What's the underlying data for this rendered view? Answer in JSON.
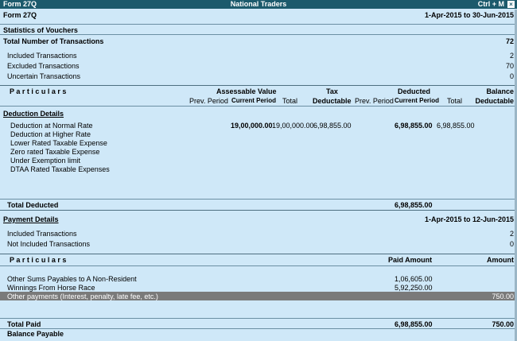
{
  "titlebar": {
    "left": "Form 27Q",
    "center": "National Traders",
    "right": "Ctrl + M",
    "close": "×"
  },
  "header": {
    "form_name": "Form 27Q",
    "period": "1-Apr-2015 to 30-Jun-2015"
  },
  "stats": {
    "title": "Statistics of Vouchers",
    "total_label": "Total Number of Transactions",
    "total_value": "72",
    "included_label": "Included Transactions",
    "included_value": "2",
    "excluded_label": "Excluded Transactions",
    "excluded_value": "70",
    "uncertain_label": "Uncertain Transactions",
    "uncertain_value": "0"
  },
  "columns": {
    "particulars": "P a r t i c u l a r s",
    "assessable": "Assessable Value",
    "tax": "Tax",
    "deducted": "Deducted",
    "balance": "Balance",
    "prev_period": "Prev. Period",
    "current_period": "Current Period",
    "total": "Total",
    "deductable": "Deductable"
  },
  "deduction": {
    "title": "Deduction Details",
    "rows": [
      {
        "label": "Deduction at Normal Rate",
        "av_current": "19,00,000.00",
        "av_total": "19,00,000.00",
        "tax": "6,98,855.00",
        "ded_current": "6,98,855.00",
        "ded_total": "6,98,855.00"
      },
      {
        "label": "Deduction at Higher Rate"
      },
      {
        "label": "Lower Rated Taxable Expense"
      },
      {
        "label": "Zero rated Taxable Expense"
      },
      {
        "label": "Under Exemption limit"
      },
      {
        "label": "DTAA Rated Taxable Expenses"
      }
    ],
    "total_label": "Total Deducted",
    "total_value": "6,98,855.00"
  },
  "payment": {
    "title": "Payment Details",
    "period": "1-Apr-2015 to 12-Jun-2015",
    "included_label": "Included Transactions",
    "included_value": "2",
    "not_included_label": "Not Included Transactions",
    "not_included_value": "0"
  },
  "payment_table": {
    "col_particulars": "P a r t i c u l a r s",
    "col_paid": "Paid Amount",
    "col_amount": "Amount",
    "rows": [
      {
        "label": "Other Sums Payables to A Non-Resident",
        "paid": "1,06,605.00",
        "amount": ""
      },
      {
        "label": "Winnings From Horse Race",
        "paid": "5,92,250.00",
        "amount": ""
      },
      {
        "label": "Other payments (Interest, penalty, late fee, etc.)",
        "paid": "",
        "amount": "750.00"
      }
    ],
    "total_label": "Total Paid",
    "total_paid": "6,98,855.00",
    "total_amount": "750.00",
    "balance_label": "Balance Payable"
  }
}
